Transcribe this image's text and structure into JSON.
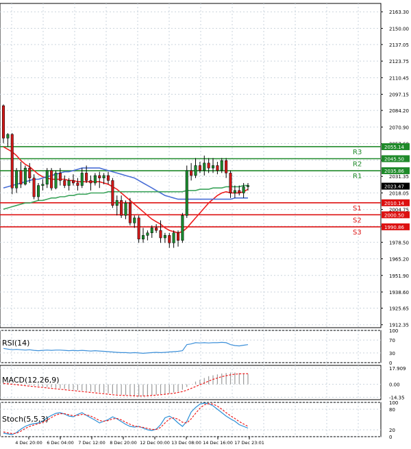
{
  "colors": {
    "background": "#ffffff",
    "frame": "#000000",
    "grid": "#c9d3dc",
    "bull_candle": "#1a8a2e",
    "bear_candle": "#d01818",
    "ma_red": "#ee1c1c",
    "ma_blue": "#4a6fd6",
    "ma_green": "#3aa35a",
    "resistance": "#1f8a2a",
    "support": "#dd1111",
    "price_tag": "#000000",
    "rsi_line": "#3b8fd9",
    "macd_hist": "#9a9a9a",
    "macd_signal": "#ee1c1c",
    "stoch_main": "#2a8fd6",
    "stoch_signal": "#ee1c1c"
  },
  "chart_data": [
    {
      "type": "candlestick",
      "panel": "price",
      "y_ticks": [
        "2163.30",
        "2150.00",
        "2137.05",
        "2123.75",
        "2110.45",
        "2097.15",
        "2084.20",
        "2070.90",
        "2057.60",
        "2044.30",
        "2031.35",
        "2018.05",
        "2004.75",
        "1991.45",
        "1978.50",
        "1965.20",
        "1951.90",
        "1938.60",
        "1925.65",
        "1912.35"
      ],
      "ylim": [
        1910.0,
        2170.0
      ],
      "x_tick_labels": [
        "4 Dec 20:00",
        "6 Dec 04:00",
        "7 Dec 12:00",
        "8 Dec 20:00",
        "12 Dec 00:00",
        "13 Dec 08:00",
        "14 Dec 16:00",
        "17 Dec 23:01"
      ],
      "candles": [
        [
          2088,
          2089,
          2058,
          2062
        ],
        [
          2062,
          2066,
          2055,
          2065
        ],
        [
          2065,
          2066,
          2017,
          2022
        ],
        [
          2022,
          2038,
          2018,
          2036
        ],
        [
          2036,
          2043,
          2022,
          2025
        ],
        [
          2025,
          2040,
          2024,
          2038
        ],
        [
          2038,
          2042,
          2026,
          2030
        ],
        [
          2030,
          2033,
          2013,
          2015
        ],
        [
          2015,
          2026,
          2012,
          2024
        ],
        [
          2024,
          2029,
          2020,
          2025
        ],
        [
          2025,
          2038,
          2022,
          2036
        ],
        [
          2036,
          2038,
          2020,
          2022
        ],
        [
          2022,
          2036,
          2021,
          2034
        ],
        [
          2034,
          2038,
          2024,
          2028
        ],
        [
          2028,
          2032,
          2022,
          2024
        ],
        [
          2024,
          2030,
          2020,
          2028
        ],
        [
          2028,
          2033,
          2024,
          2026
        ],
        [
          2026,
          2030,
          2020,
          2024
        ],
        [
          2024,
          2038,
          2022,
          2034
        ],
        [
          2034,
          2040,
          2026,
          2028
        ],
        [
          2028,
          2032,
          2020,
          2026
        ],
        [
          2026,
          2034,
          2024,
          2032
        ],
        [
          2032,
          2035,
          2022,
          2030
        ],
        [
          2030,
          2034,
          2025,
          2032
        ],
        [
          2032,
          2035,
          2025,
          2028
        ],
        [
          2028,
          2030,
          2006,
          2008
        ],
        [
          2008,
          2016,
          2000,
          2012
        ],
        [
          2012,
          2016,
          1998,
          2000
        ],
        [
          2000,
          2012,
          1997,
          2010
        ],
        [
          2010,
          2014,
          1992,
          1994
        ],
        [
          1994,
          2000,
          1990,
          1998
        ],
        [
          1998,
          2000,
          1978,
          1981
        ],
        [
          1981,
          1990,
          1978,
          1984
        ],
        [
          1984,
          1988,
          1980,
          1986
        ],
        [
          1986,
          1992,
          1982,
          1990
        ],
        [
          1990,
          1993,
          1986,
          1988
        ],
        [
          1988,
          1996,
          1978,
          1982
        ],
        [
          1982,
          1986,
          1978,
          1984
        ],
        [
          1984,
          1986,
          1974,
          1978
        ],
        [
          1978,
          1988,
          1974,
          1986
        ],
        [
          1986,
          1988,
          1975,
          1980
        ],
        [
          1980,
          2002,
          1978,
          2000
        ],
        [
          2000,
          2040,
          1998,
          2036
        ],
        [
          2036,
          2042,
          2028,
          2032
        ],
        [
          2032,
          2046,
          2030,
          2040
        ],
        [
          2040,
          2043,
          2034,
          2036
        ],
        [
          2036,
          2048,
          2032,
          2042
        ],
        [
          2042,
          2046,
          2034,
          2038
        ],
        [
          2038,
          2046,
          2034,
          2040
        ],
        [
          2040,
          2043,
          2033,
          2036
        ],
        [
          2036,
          2046,
          2034,
          2044
        ],
        [
          2044,
          2046,
          2030,
          2034
        ],
        [
          2034,
          2036,
          2014,
          2018
        ],
        [
          2018,
          2024,
          2014,
          2020
        ],
        [
          2020,
          2024,
          2016,
          2018
        ],
        [
          2018,
          2026,
          2014,
          2023
        ],
        [
          2023,
          2026,
          2020,
          2024
        ]
      ],
      "series": [
        {
          "values": [
            2055,
            2053,
            2051,
            2048,
            2044,
            2041,
            2039,
            2036,
            2033,
            2031,
            2030,
            2029,
            2029,
            2029,
            2029,
            2028,
            2028,
            2027,
            2027,
            2027,
            2027,
            2027,
            2027,
            2026,
            2025,
            2023,
            2021,
            2018,
            2015,
            2012,
            2009,
            2006,
            2003,
            2000,
            1997,
            1995,
            1993,
            1990,
            1988,
            1987,
            1986,
            1987,
            1990,
            1994,
            1998,
            2002,
            2006,
            2010,
            2013,
            2016,
            2018,
            2019,
            2018,
            2018,
            2018,
            2019,
            2021
          ]
        },
        {
          "values": [
            2022,
            2023,
            2024,
            2025,
            2026,
            2027,
            2028,
            2029,
            2029,
            2030,
            2031,
            2032,
            2033,
            2034,
            2035,
            2035,
            2036,
            2037,
            2038,
            2038,
            2038,
            2038,
            2038,
            2037,
            2036,
            2035,
            2034,
            2033,
            2032,
            2031,
            2030,
            2028,
            2026,
            2024,
            2022,
            2020,
            2018,
            2016,
            2015,
            2014,
            2013,
            2013,
            2013,
            2013,
            2013,
            2013,
            2013,
            2013,
            2013,
            2013,
            2013,
            2013,
            2013,
            2014,
            2014,
            2014,
            2014
          ]
        },
        {
          "values": [
            2005,
            2006,
            2007,
            2008,
            2009,
            2010,
            2010,
            2011,
            2012,
            2012,
            2013,
            2014,
            2014,
            2015,
            2015,
            2016,
            2016,
            2017,
            2017,
            2017,
            2018,
            2018,
            2018,
            2018,
            2019,
            2019,
            2019,
            2019,
            2019,
            2019,
            2019,
            2019,
            2019,
            2019,
            2019,
            2019,
            2019,
            2019,
            2019,
            2019,
            2019,
            2019,
            2020,
            2020,
            2020,
            2021,
            2021,
            2021,
            2022,
            2022,
            2022,
            2023,
            2023,
            2023,
            2023,
            2024,
            2024
          ]
        }
      ],
      "levels": [
        {
          "label": "R3",
          "value": 2055.14,
          "tag": "2055.14",
          "kind": "resistance"
        },
        {
          "label": "R2",
          "value": 2045.5,
          "tag": "2045.50",
          "kind": "resistance"
        },
        {
          "label": "R1",
          "value": 2035.86,
          "tag": "2035.86",
          "kind": "resistance"
        },
        {
          "label": "S1",
          "value": 2010.14,
          "tag": "2010.14",
          "kind": "support"
        },
        {
          "label": "S2",
          "value": 2000.5,
          "tag": "2000.50",
          "kind": "support"
        },
        {
          "label": "S3",
          "value": 1990.86,
          "tag": "1990.86",
          "kind": "support"
        }
      ],
      "last_price": {
        "value": 2023.47,
        "tag": "2023.47"
      }
    },
    {
      "type": "line",
      "panel": "rsi",
      "title": "RSI(14)",
      "ylim": [
        0,
        100
      ],
      "y_ticks": [
        {
          "value": 100,
          "label": "100"
        },
        {
          "value": 70,
          "label": "70"
        },
        {
          "value": 30,
          "label": "30"
        },
        {
          "value": 0,
          "label": "0"
        }
      ],
      "values": [
        44,
        42,
        40,
        41,
        40,
        39,
        40,
        38,
        37,
        38,
        39,
        38,
        39,
        39,
        38,
        37,
        38,
        37,
        38,
        37,
        36,
        37,
        36,
        35,
        34,
        33,
        32,
        31,
        31,
        30,
        31,
        30,
        29,
        30,
        31,
        32,
        31,
        32,
        33,
        34,
        35,
        37,
        56,
        58,
        62,
        61,
        62,
        61,
        62,
        62,
        63,
        62,
        56,
        53,
        52,
        54,
        56
      ]
    },
    {
      "type": "bar",
      "panel": "macd",
      "title": "MACD(12,26,9)",
      "ylim": [
        -17.0,
        21.0
      ],
      "y_ticks": [
        {
          "value": 17.909,
          "label": "17.909"
        },
        {
          "value": 0.0,
          "label": "0.00"
        },
        {
          "value": -14.35,
          "label": "-14.35"
        }
      ],
      "values": [
        2,
        1.5,
        1,
        0.5,
        0,
        -0.5,
        -1,
        -1.5,
        -2,
        -2.5,
        -3,
        -3.5,
        -4,
        -4.5,
        -5,
        -5.5,
        -6,
        -6.5,
        -7,
        -7.5,
        -8,
        -8.5,
        -9,
        -9.5,
        -10,
        -10.5,
        -11,
        -11.5,
        -12,
        -12.5,
        -13,
        -13.5,
        -13,
        -12.5,
        -12,
        -11.5,
        -11,
        -10.5,
        -10,
        -9,
        -8,
        -6,
        -3,
        0,
        3,
        5,
        7,
        9,
        10,
        11,
        12,
        12.5,
        13,
        13,
        12.5,
        12,
        11.5
      ],
      "signal": [
        1,
        0.5,
        0,
        -0.5,
        -1,
        -1.5,
        -2,
        -2.5,
        -3,
        -3.5,
        -4,
        -4.5,
        -5,
        -5.5,
        -6,
        -6.5,
        -7,
        -7.5,
        -8,
        -8.5,
        -9,
        -9.5,
        -10,
        -10.5,
        -11,
        -11.5,
        -12,
        -12.2,
        -12.4,
        -12.6,
        -12.8,
        -13,
        -13,
        -12.8,
        -12.4,
        -12,
        -11.5,
        -11,
        -10.5,
        -10,
        -9,
        -8,
        -6.5,
        -4.5,
        -2.5,
        -0.5,
        1.5,
        3.5,
        5.5,
        7,
        8.5,
        9.5,
        10.5,
        11.2,
        11.6,
        11.8,
        11.8
      ]
    },
    {
      "type": "line",
      "panel": "stoch",
      "title": "Stoch(5,5,3)",
      "ylim": [
        0,
        100
      ],
      "y_ticks": [
        {
          "value": 100,
          "label": "100"
        },
        {
          "value": 80,
          "label": "80"
        },
        {
          "value": 20,
          "label": "20"
        },
        {
          "value": 0,
          "label": "0"
        }
      ],
      "series": [
        {
          "values": [
            10,
            8,
            6,
            12,
            22,
            30,
            35,
            38,
            40,
            45,
            55,
            62,
            68,
            70,
            66,
            60,
            58,
            65,
            70,
            62,
            55,
            48,
            40,
            45,
            50,
            58,
            52,
            44,
            36,
            30,
            28,
            30,
            25,
            20,
            18,
            22,
            35,
            55,
            60,
            52,
            40,
            30,
            45,
            72,
            85,
            95,
            98,
            96,
            90,
            80,
            70,
            60,
            52,
            45,
            35,
            30,
            25
          ]
        },
        {
          "values": [
            14,
            11,
            9,
            10,
            16,
            24,
            30,
            34,
            38,
            41,
            48,
            56,
            63,
            67,
            67,
            64,
            61,
            62,
            65,
            64,
            60,
            54,
            47,
            45,
            47,
            52,
            53,
            49,
            42,
            36,
            31,
            29,
            27,
            24,
            21,
            21,
            27,
            40,
            52,
            55,
            51,
            42,
            40,
            52,
            68,
            83,
            93,
            96,
            95,
            89,
            80,
            70,
            61,
            53,
            44,
            37,
            30
          ]
        }
      ]
    }
  ]
}
